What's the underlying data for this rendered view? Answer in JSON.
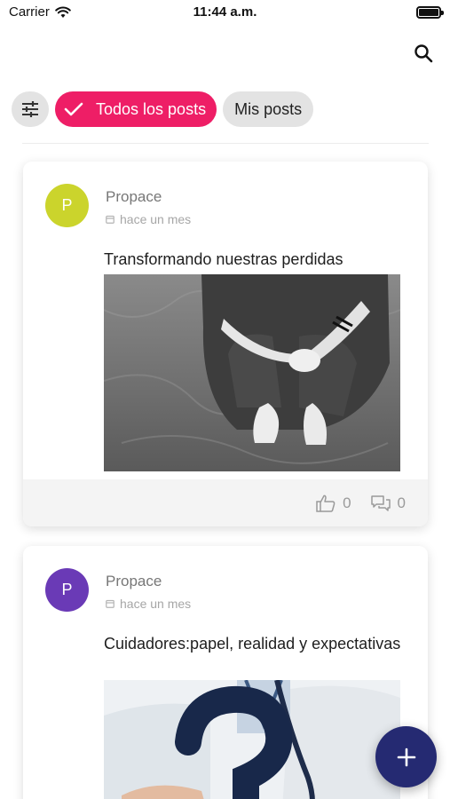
{
  "status_bar": {
    "carrier": "Carrier",
    "time": "11:44 a.m."
  },
  "header": {
    "search_icon": "search-icon"
  },
  "filters": {
    "settings_icon": "sliders-icon",
    "chips": [
      {
        "label": "Todos los posts",
        "selected": true
      },
      {
        "label": "Mis posts",
        "selected": false
      }
    ]
  },
  "posts": [
    {
      "avatar_letter": "P",
      "avatar_color": "#cbd42c",
      "author": "Propace",
      "date": "hace un mes",
      "title": "Transformando nuestras perdidas",
      "likes": "0",
      "comments": "0"
    },
    {
      "avatar_letter": "P",
      "avatar_color": "#6a3ab6",
      "author": "Propace",
      "date": "hace un mes",
      "title": "Cuidadores:papel, realidad y expectativas"
    }
  ],
  "colors": {
    "accent": "#ee1e66",
    "fab": "#252a72"
  },
  "fab": {
    "icon": "plus-icon"
  }
}
